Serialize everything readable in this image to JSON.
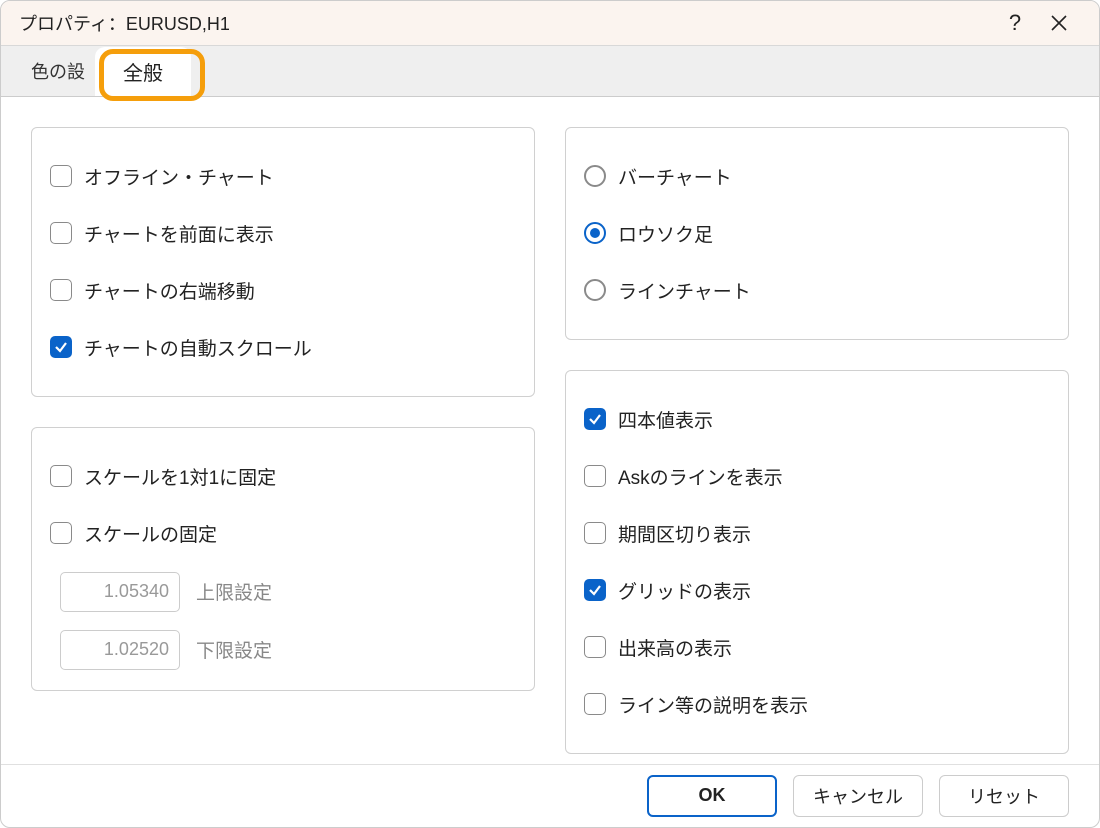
{
  "window": {
    "title": "プロパティ：EURUSD,H1"
  },
  "tabs": {
    "inactive": "色の設",
    "active": "全般"
  },
  "left_group1": {
    "items": [
      {
        "label": "オフライン・チャート",
        "checked": false
      },
      {
        "label": "チャートを前面に表示",
        "checked": false
      },
      {
        "label": "チャートの右端移動",
        "checked": false
      },
      {
        "label": "チャートの自動スクロール",
        "checked": true
      }
    ]
  },
  "left_group2": {
    "items": [
      {
        "label": "スケールを1対1に固定",
        "checked": false
      },
      {
        "label": "スケールの固定",
        "checked": false
      }
    ],
    "upper": {
      "value": "1.05340",
      "label": "上限設定"
    },
    "lower": {
      "value": "1.02520",
      "label": "下限設定"
    }
  },
  "right_group1": {
    "items": [
      {
        "label": "バーチャート",
        "checked": false
      },
      {
        "label": "ロウソク足",
        "checked": true
      },
      {
        "label": "ラインチャート",
        "checked": false
      }
    ]
  },
  "right_group2": {
    "items": [
      {
        "label": "四本値表示",
        "checked": true
      },
      {
        "label": "Askのラインを表示",
        "checked": false
      },
      {
        "label": "期間区切り表示",
        "checked": false
      },
      {
        "label": "グリッドの表示",
        "checked": true
      },
      {
        "label": "出来高の表示",
        "checked": false
      },
      {
        "label": "ライン等の説明を表示",
        "checked": false
      }
    ]
  },
  "footer": {
    "ok": "OK",
    "cancel": "キャンセル",
    "reset": "リセット"
  }
}
